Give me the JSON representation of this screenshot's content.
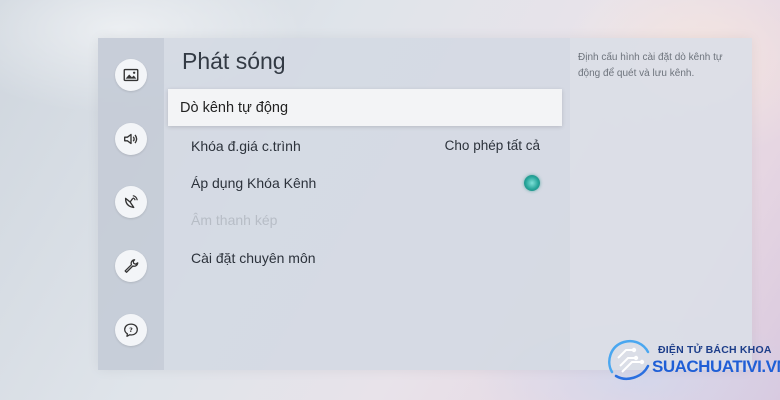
{
  "rail": {
    "items": [
      {
        "icon": "picture-icon",
        "label": ""
      },
      {
        "icon": "sound-icon",
        "label": ""
      },
      {
        "icon": "broadcast-icon",
        "label": ""
      },
      {
        "icon": "wrench-icon",
        "label": ""
      },
      {
        "icon": "support-icon",
        "label": ""
      }
    ]
  },
  "menu": {
    "title": "Phát sóng",
    "items": [
      {
        "label": "Dò kênh tự động",
        "value": "",
        "state": "focused"
      },
      {
        "label": "Khóa đ.giá c.trình",
        "value": "Cho phép tất cả",
        "state": "normal"
      },
      {
        "label": "Áp dụng Khóa Kênh",
        "value": "",
        "state": "toggle-on"
      },
      {
        "label": "Âm thanh kép",
        "value": "",
        "state": "disabled"
      },
      {
        "label": "Cài đặt chuyên môn",
        "value": "",
        "state": "normal"
      }
    ]
  },
  "help": {
    "text": "Định cấu hình cài đặt dò kênh tự động để quét và lưu kênh."
  },
  "watermark": {
    "line1": "ĐIỆN TỬ BÁCH KHOA",
    "line2": "SUACHUATIVI.VN"
  },
  "colors": {
    "toggle_on": "#27a59a",
    "watermark_primary": "#1f5fd6",
    "watermark_secondary": "#1d3e8a"
  }
}
